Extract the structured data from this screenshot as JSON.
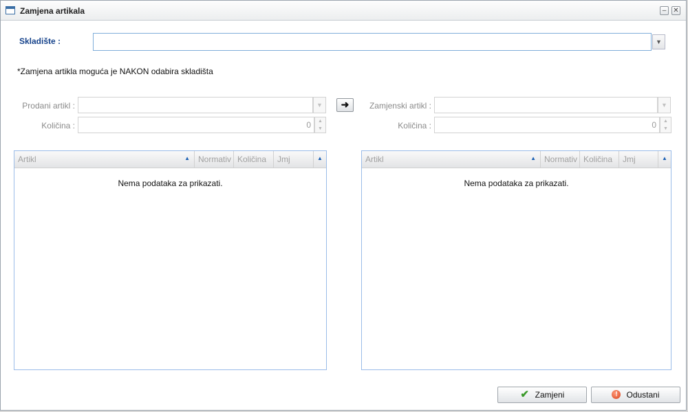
{
  "window": {
    "title": "Zamjena artikala",
    "minimize_glyph": "–",
    "close_glyph": "✕"
  },
  "warehouse": {
    "label": "Skladište :",
    "value": "",
    "trigger_glyph": "▼"
  },
  "note": "*Zamjena artikla moguća je NAKON odabira skladišta",
  "left_form": {
    "article_label": "Prodani artikl :",
    "quantity_label": "Količina :",
    "quantity_value": "0"
  },
  "right_form": {
    "article_label": "Zamjenski artikl :",
    "quantity_label": "Količina :",
    "quantity_value": "0"
  },
  "transfer_button": {
    "glyph": "➜"
  },
  "grids": {
    "columns": [
      "Artikl",
      "Normativ",
      "Količina",
      "Jmj"
    ],
    "empty_text": "Nema podataka za prikazati."
  },
  "footer": {
    "confirm_label": "Zamjeni",
    "cancel_label": "Odustani"
  },
  "colors": {
    "accent_label": "#15428b",
    "grid_border": "#99bbe8",
    "confirm_icon": "#3a9a2a",
    "cancel_icon": "#d9431c"
  },
  "icons": {
    "window": "window-icon",
    "confirm": "check-icon",
    "cancel": "stop-icon",
    "transfer": "arrow-right-icon"
  }
}
